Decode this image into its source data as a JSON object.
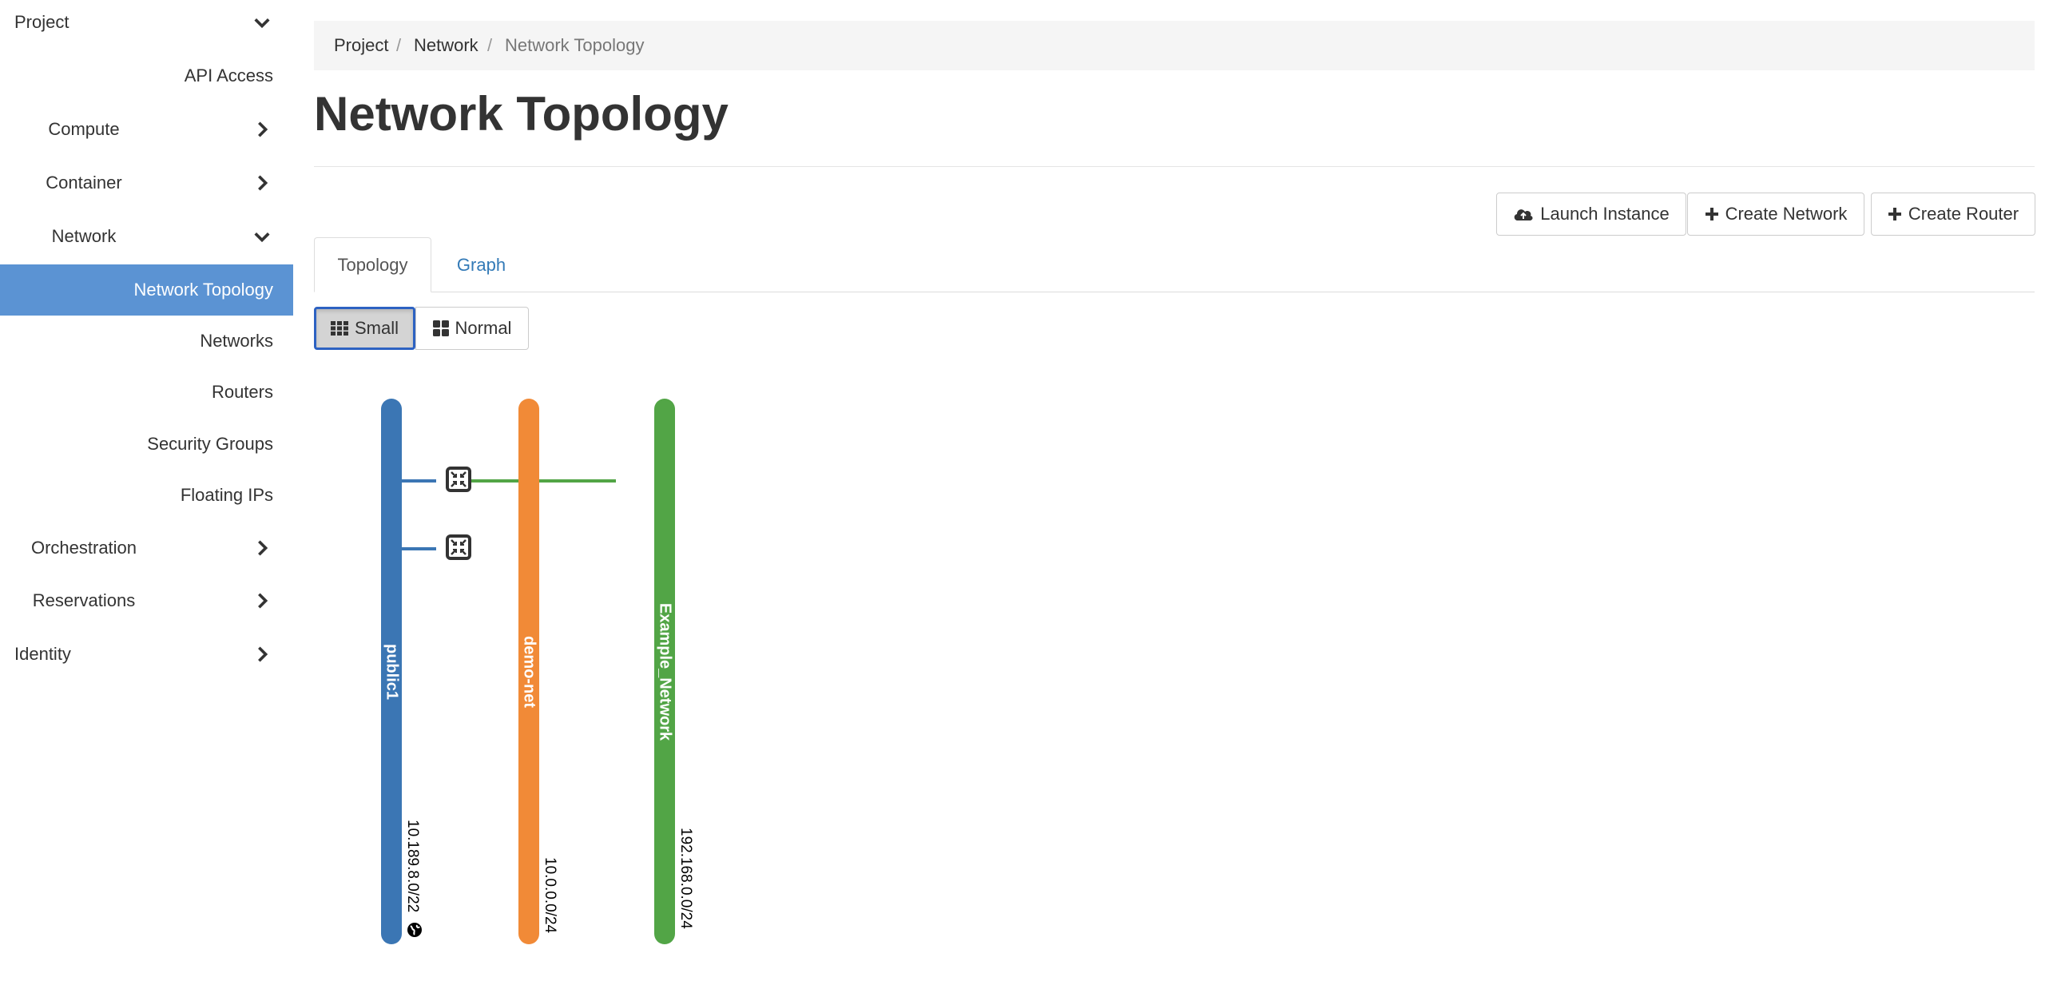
{
  "sidebar": {
    "items": [
      {
        "label": "Project",
        "level": 0,
        "chevron": "down"
      },
      {
        "label": "API Access",
        "level": 2,
        "chevron": ""
      },
      {
        "label": "Compute",
        "level": 1,
        "chevron": "right"
      },
      {
        "label": "Container",
        "level": 1,
        "chevron": "right"
      },
      {
        "label": "Network",
        "level": 1,
        "chevron": "down"
      },
      {
        "label": "Network Topology",
        "level": 2,
        "chevron": "",
        "active": true
      },
      {
        "label": "Networks",
        "level": 2,
        "chevron": ""
      },
      {
        "label": "Routers",
        "level": 2,
        "chevron": ""
      },
      {
        "label": "Security Groups",
        "level": 2,
        "chevron": ""
      },
      {
        "label": "Floating IPs",
        "level": 2,
        "chevron": ""
      },
      {
        "label": "Orchestration",
        "level": 1,
        "chevron": "right"
      },
      {
        "label": "Reservations",
        "level": 1,
        "chevron": "right"
      },
      {
        "label": "Identity",
        "level": 0,
        "chevron": "right"
      }
    ]
  },
  "breadcrumb": [
    "Project",
    "Network",
    "Network Topology"
  ],
  "page": {
    "title": "Network Topology"
  },
  "actions": {
    "launch_instance": "Launch Instance",
    "create_network": "Create Network",
    "create_router": "Create Router"
  },
  "tabs": [
    "Topology",
    "Graph"
  ],
  "view_toggle": {
    "small": "Small",
    "normal": "Normal",
    "selected": "Small"
  },
  "topology": {
    "networks": [
      {
        "name": "public1",
        "cidr": "10.189.8.0/22",
        "color": "#3b76b4",
        "external": true
      },
      {
        "name": "demo-net",
        "cidr": "10.0.0.0/24",
        "color": "#f18a37",
        "external": false
      },
      {
        "name": "Example_Network",
        "cidr": "192.168.0.0/24",
        "color": "#52a546",
        "external": false
      }
    ],
    "routers": [
      {
        "icon": "router-icon",
        "connected_networks": [
          "public1",
          "Example_Network"
        ]
      },
      {
        "icon": "router-icon",
        "connected_networks": [
          "public1"
        ]
      }
    ]
  },
  "colors": {
    "accent": "#5b93d3",
    "link": "#337ab7",
    "active_border": "#2d62c2"
  }
}
